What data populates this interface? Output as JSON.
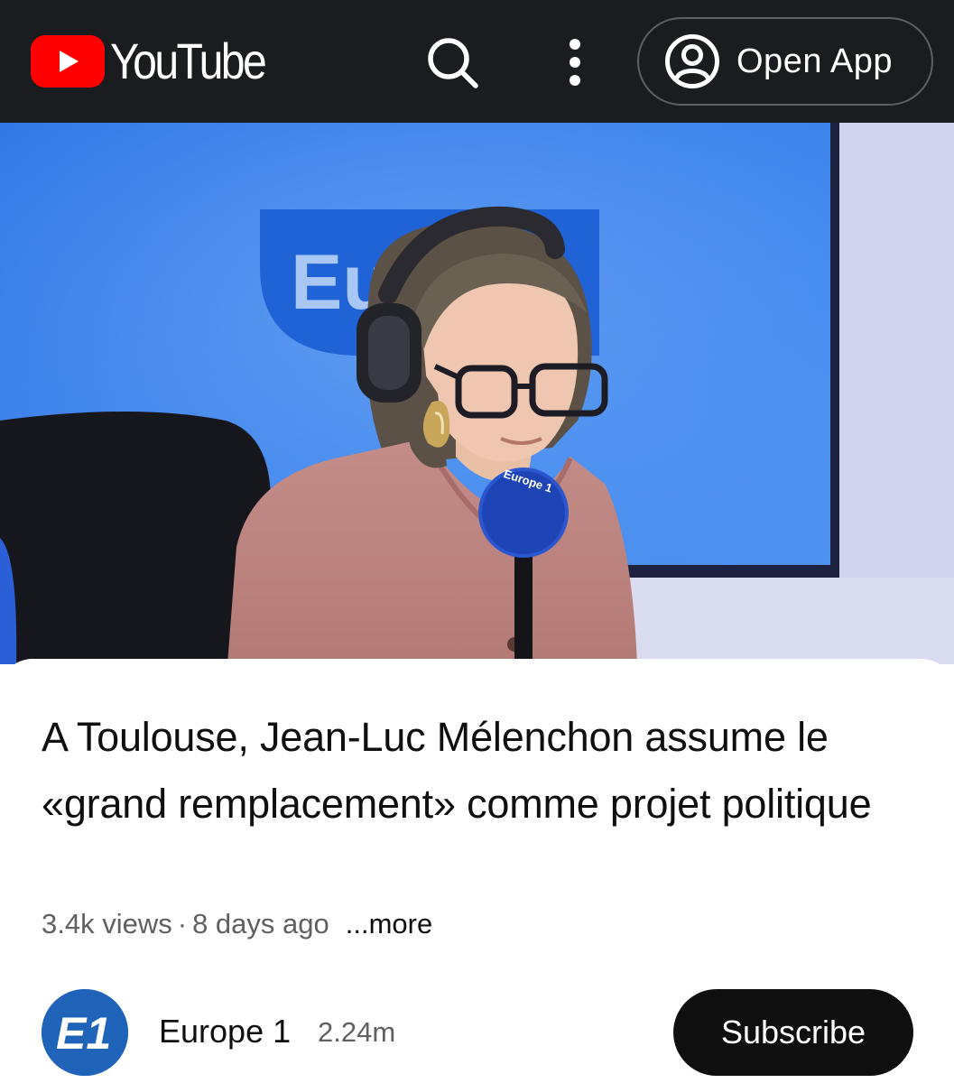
{
  "header": {
    "logo_text": "YouTube",
    "open_app_label": "Open App",
    "icons": {
      "logo": "youtube-play-icon",
      "search": "search-icon",
      "more": "kebab-menu-icon",
      "account": "account-circle-icon"
    }
  },
  "video": {
    "studio_logo_text": "Eur",
    "mic_logo_text": "Europe 1"
  },
  "details": {
    "title": "A Toulouse, Jean-Luc Mélenchon assume le «grand remplacement» comme projet politique",
    "views": "3.4k views",
    "separator": "·",
    "age": "8 days ago",
    "more_label": "...more"
  },
  "channel": {
    "avatar_text": "E1",
    "name": "Europe 1",
    "subscribers": "2.24m",
    "subscribe_label": "Subscribe"
  },
  "colors": {
    "topbar_bg": "#1b1c20",
    "brand_red": "#ff0000",
    "studio_blue": "#3a7fe8",
    "subscribe_bg": "#0f0f0f",
    "meta_gray": "#606060"
  }
}
